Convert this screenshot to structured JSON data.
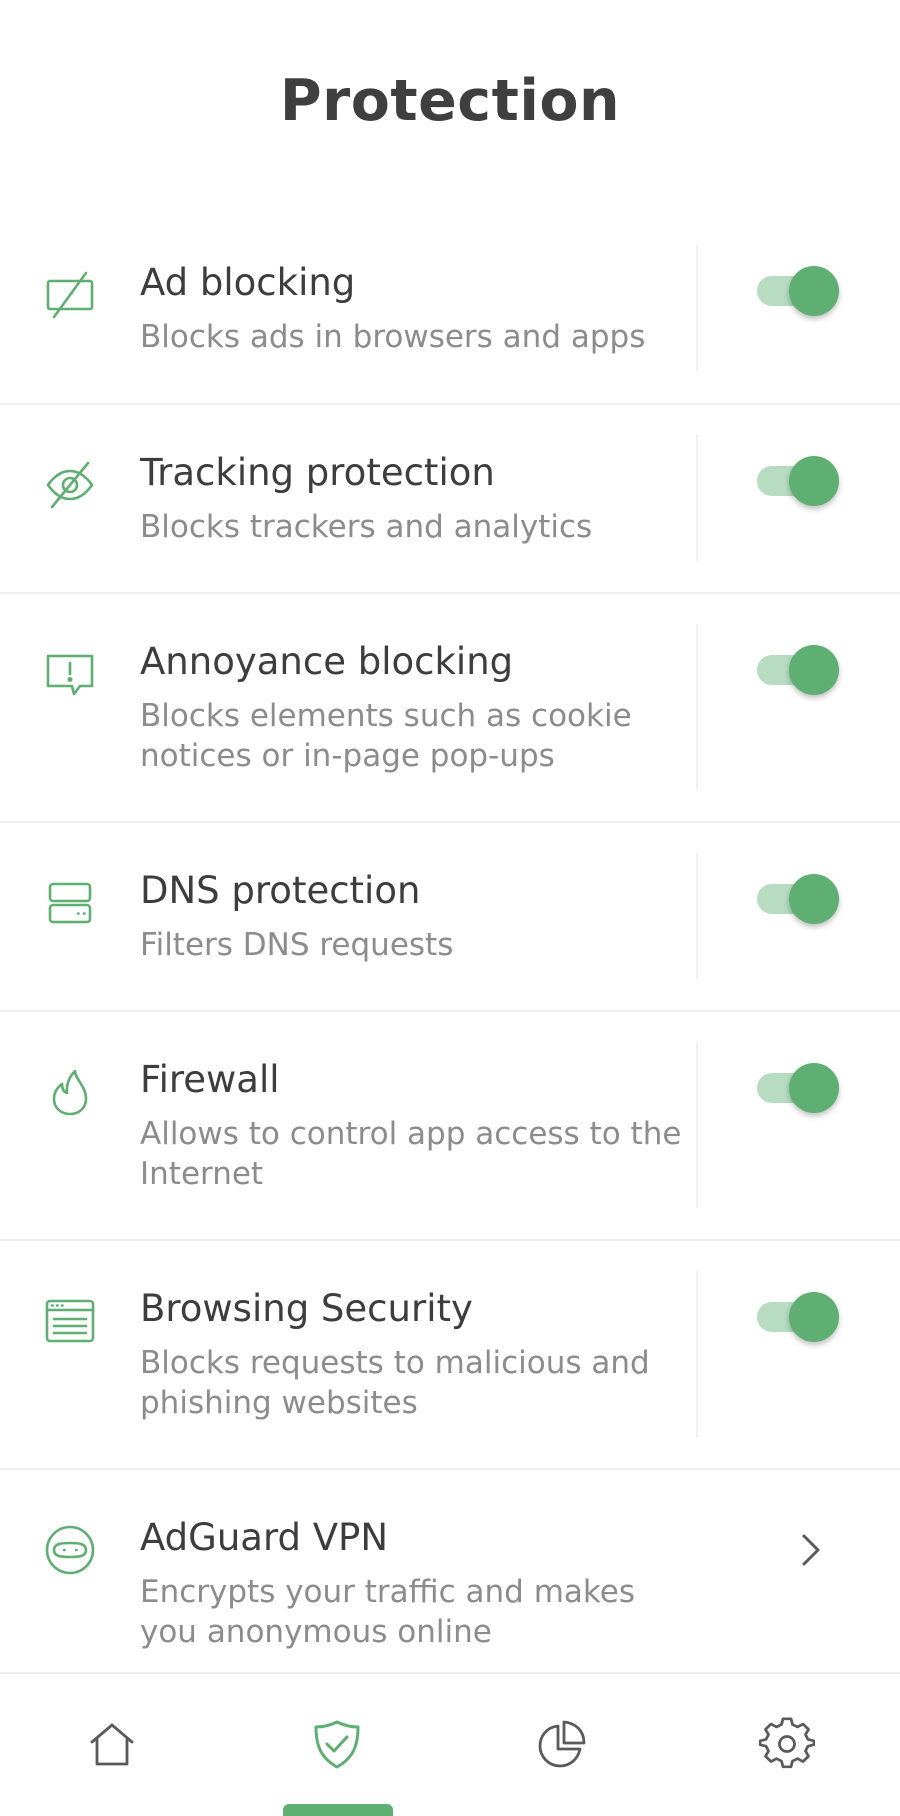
{
  "header": {
    "title": "Protection"
  },
  "colors": {
    "accent": "#5fae72",
    "accent_light": "#b7dcc2",
    "icon": "#5fae72",
    "text_primary": "#3d3d3d",
    "text_secondary": "#8c8c8c"
  },
  "items": [
    {
      "id": "ad-blocking",
      "icon": "ad-blocking-icon",
      "title": "Ad blocking",
      "description": "Blocks ads in browsers and apps",
      "control": "toggle",
      "enabled": true
    },
    {
      "id": "tracking-protection",
      "icon": "eye-slash-icon",
      "title": "Tracking protection",
      "description": "Blocks trackers and analytics",
      "control": "toggle",
      "enabled": true
    },
    {
      "id": "annoyance-blocking",
      "icon": "exclamation-bubble-icon",
      "title": "Annoyance blocking",
      "description": "Blocks elements such as cookie notices or in-page pop-ups",
      "control": "toggle",
      "enabled": true
    },
    {
      "id": "dns-protection",
      "icon": "server-icon",
      "title": "DNS protection",
      "description": "Filters DNS requests",
      "control": "toggle",
      "enabled": true
    },
    {
      "id": "firewall",
      "icon": "flame-icon",
      "title": "Firewall",
      "description": "Allows to control app access to the Internet",
      "control": "toggle",
      "enabled": true
    },
    {
      "id": "browsing-security",
      "icon": "browser-window-icon",
      "title": "Browsing Security",
      "description": "Blocks requests to malicious and phishing websites",
      "control": "toggle",
      "enabled": true
    },
    {
      "id": "adguard-vpn",
      "icon": "vpn-robot-icon",
      "title": "AdGuard VPN",
      "description": "Encrypts your traffic and makes you anonymous online",
      "control": "chevron"
    }
  ],
  "bottom_nav": {
    "items": [
      {
        "id": "home",
        "icon": "home-icon"
      },
      {
        "id": "protection",
        "icon": "shield-check-icon",
        "active": true
      },
      {
        "id": "statistics",
        "icon": "pie-chart-icon"
      },
      {
        "id": "settings",
        "icon": "gear-icon"
      }
    ]
  }
}
